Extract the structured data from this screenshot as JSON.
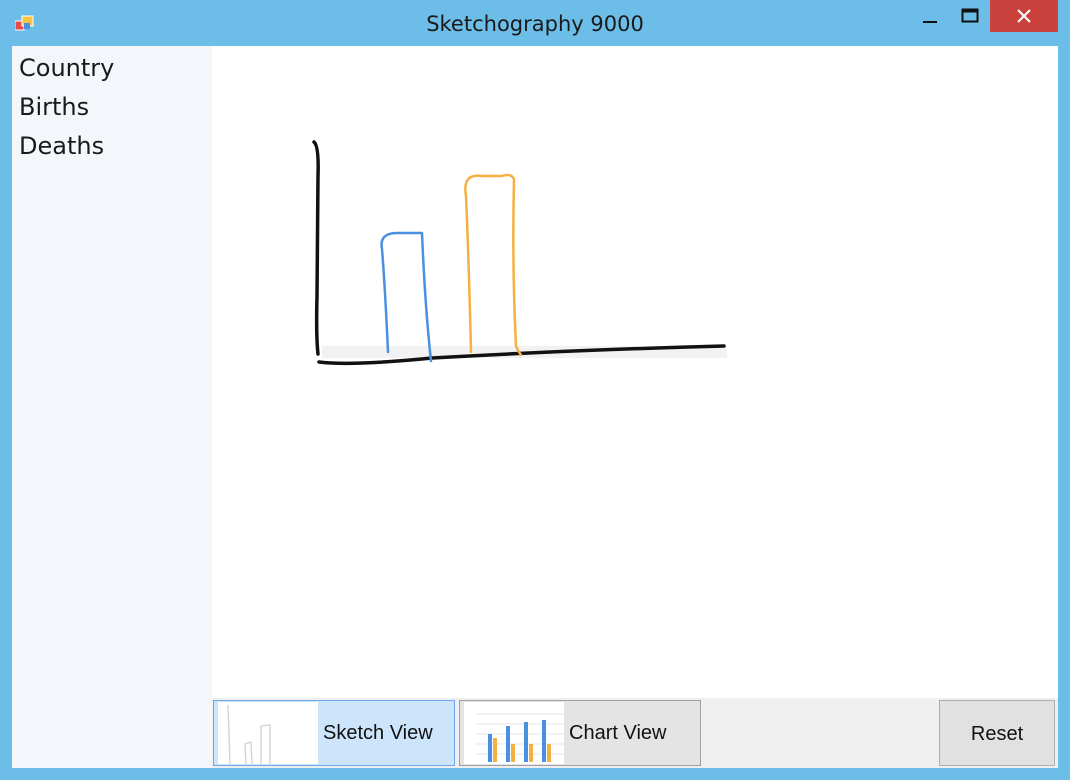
{
  "window": {
    "title": "Sketchography 9000",
    "accent_color": "#6cbde8",
    "close_color": "#c9423d",
    "controls": [
      "minimize-icon",
      "maximize-icon",
      "close-icon"
    ]
  },
  "sidebar": {
    "fields": [
      "Country",
      "Births",
      "Deaths"
    ]
  },
  "canvas": {
    "sketch_colors": {
      "axis": "#111111",
      "bar1": "#4a90e2",
      "bar2": "#f5b041"
    }
  },
  "bottom": {
    "sketch_view_label": "Sketch View",
    "chart_view_label": "Chart View",
    "reset_label": "Reset",
    "active_view": "Sketch View"
  }
}
